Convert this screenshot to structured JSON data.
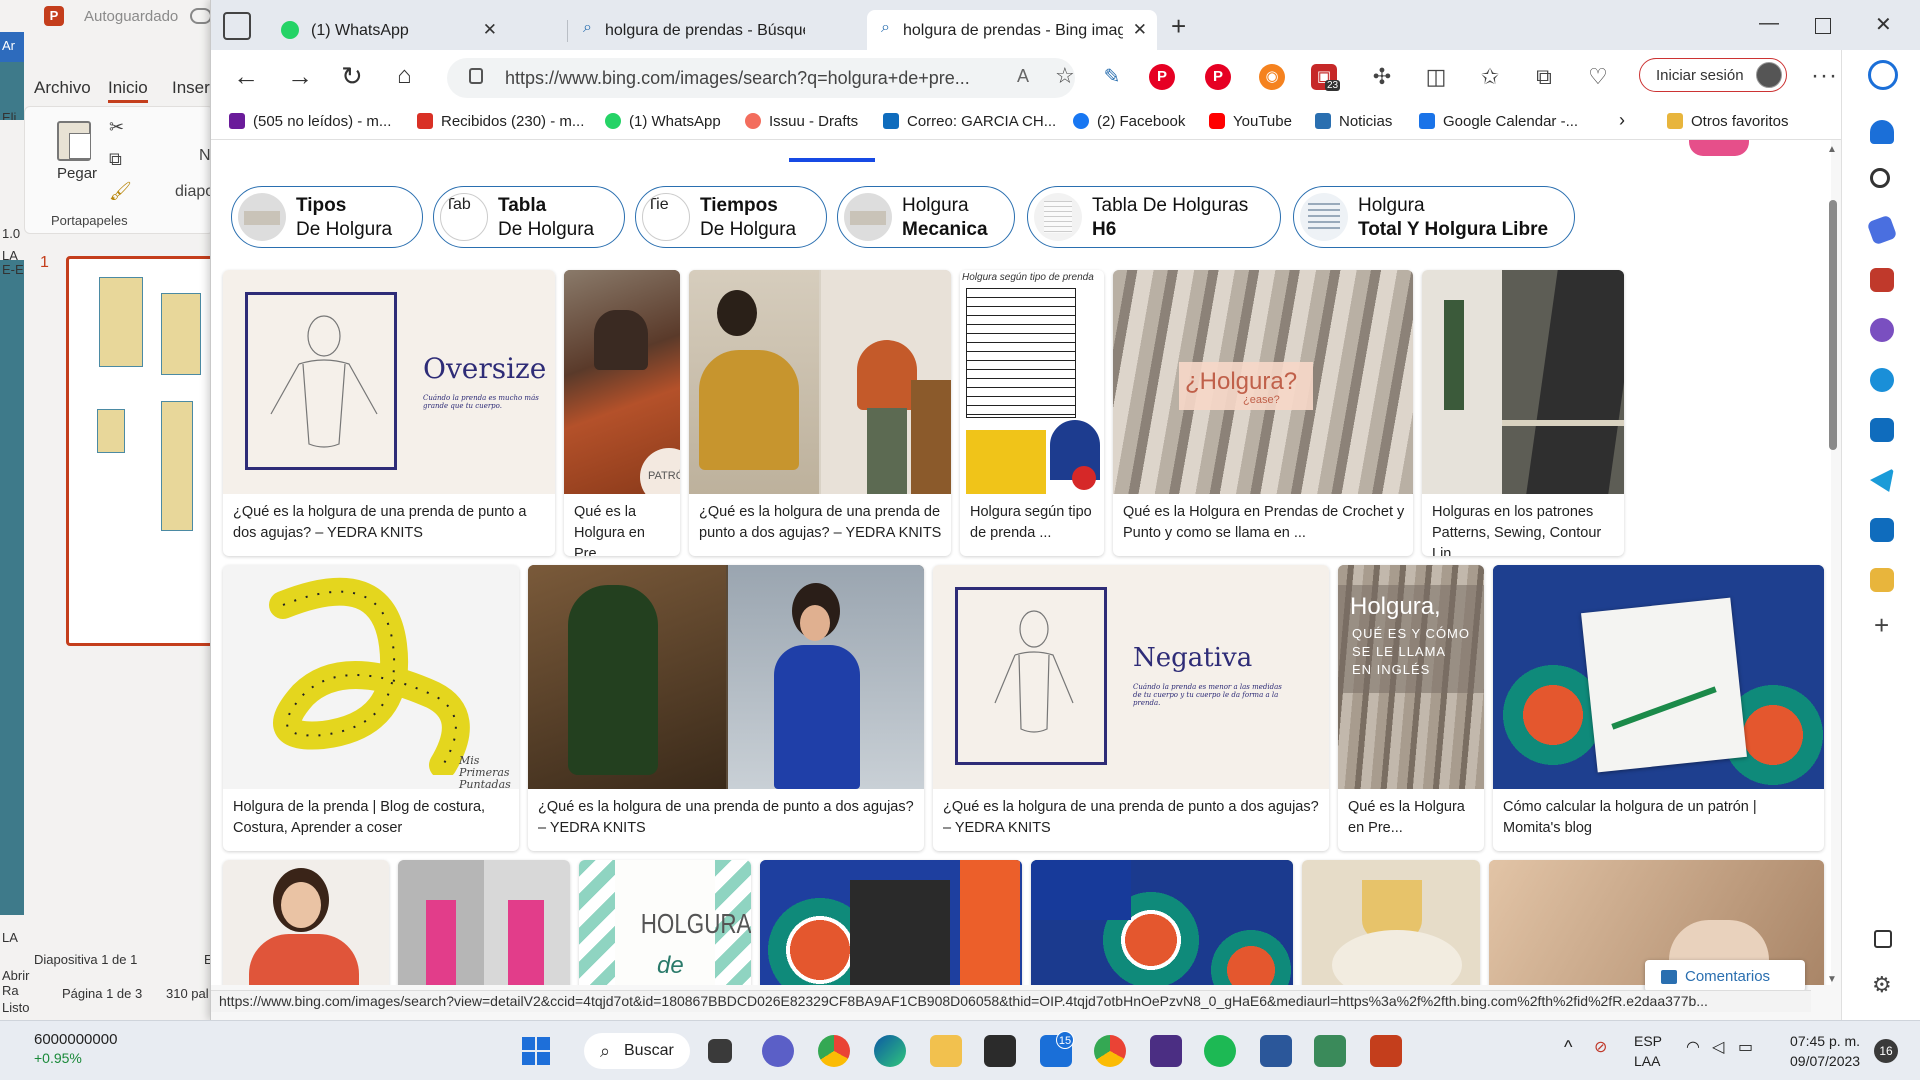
{
  "powerpoint": {
    "autosave_label": "Autoguardado",
    "left_labels": [
      "Ar",
      "Eli",
      "1.0",
      "LA",
      "E-E",
      "LA",
      "Abrir Ra",
      "Listo"
    ],
    "menu": [
      "Archivo",
      "Inicio",
      "Inser"
    ],
    "paste_label": "Pegar",
    "clipboard_group": "Portapapeles",
    "new_slide_label": "N",
    "slides_label": "diapo",
    "slide_number": "1",
    "status_slide": "Diapositiva 1 de 1",
    "status_e": "E",
    "status_page": "Página 1 de 3",
    "status_words": "310 pal"
  },
  "browser": {
    "tabs": [
      {
        "label": "(1) WhatsApp",
        "icon": "whatsapp-icon",
        "color": "#25d366"
      },
      {
        "label": "holgura de prendas - Búsqueda",
        "icon": "search-icon",
        "color": "#2a6fb0"
      },
      {
        "label": "holgura de prendas - Bing image",
        "icon": "search-icon",
        "color": "#2a6fb0"
      }
    ],
    "url": "https://www.bing.com/images/search?q=holgura+de+pre...",
    "read_aloud": "À",
    "sign_in": "Iniciar sesión",
    "ext_badge": "23",
    "favorites": [
      {
        "label": "(505 no leídos) - m...",
        "color": "#6a1b9a"
      },
      {
        "label": "Recibidos (230) - m...",
        "color": "#d93025"
      },
      {
        "label": "(1) WhatsApp",
        "color": "#25d366"
      },
      {
        "label": "Issuu - Drafts",
        "color": "#f36d5d"
      },
      {
        "label": "Correo: GARCIA CH...",
        "color": "#0f6cbd"
      },
      {
        "label": "(2) Facebook",
        "color": "#1877f2"
      },
      {
        "label": "YouTube",
        "color": "#ff0000"
      },
      {
        "label": "Noticias",
        "color": "#2a6fb0"
      },
      {
        "label": "Google Calendar -...",
        "color": "#1a73e8"
      }
    ],
    "other_favorites": "Otros favoritos",
    "status_url": "https://www.bing.com/images/search?view=detailV2&ccid=4tqjd7ot&id=180867BBDCD026E82329CF8BA9AF1CB908D06058&thid=OIP.4tqjd7otbHnOePzvN8_0_gHaE6&mediaurl=https%3a%2f%2fth.bing.com%2fth%2fid%2fR.e2daa377b...",
    "comments": "Comentarios"
  },
  "chips": [
    {
      "l1": "Tipos",
      "l2": "De Holgura",
      "bold_line": 1
    },
    {
      "l1": "Tabla",
      "l2": "De Holgura",
      "bold_line": 1
    },
    {
      "l1": "Tiempos",
      "l2": "De Holgura",
      "bold_line": 1
    },
    {
      "l1": "Holgura",
      "l2": "Mecanica",
      "bold_line": 2
    },
    {
      "l1": "Tabla De Holguras",
      "l2": "H6",
      "bold_line": 2
    },
    {
      "l1": "Holgura",
      "l2": "Total Y Holgura Libre",
      "bold_line": 2
    }
  ],
  "chip_alt_texts": [
    "Tab",
    "Tie"
  ],
  "results": [
    {
      "caption": "¿Qué es la holgura de una prenda de punto a dos agujas? – YEDRA KNITS",
      "img_text": "Oversize"
    },
    {
      "caption": "Qué es la Holgura en Pre...",
      "img_text": "PATRÓN"
    },
    {
      "caption": "¿Qué es la holgura de una prenda de punto a dos agujas? – YEDRA KNITS",
      "img_text": ""
    },
    {
      "caption": "Holgura según tipo de prenda ...",
      "img_text": "Holgura según tipo de prenda"
    },
    {
      "caption": "Qué es la Holgura en Prendas de Crochet y Punto y como se llama en ...",
      "img_text": "¿Holgura?"
    },
    {
      "caption": "Holguras en los patrones Patterns, Sewing, Contour Lin...",
      "img_text": ""
    },
    {
      "caption": "Holgura de la prenda | Blog de costura, Costura, Aprender a coser",
      "img_text": "Mis Primeras Puntadas"
    },
    {
      "caption": "¿Qué es la holgura de una prenda de punto a dos agujas? – YEDRA KNITS",
      "img_text": ""
    },
    {
      "caption": "¿Qué es la holgura de una prenda de punto a dos agujas? – YEDRA KNITS",
      "img_text": "Negativa"
    },
    {
      "caption": "Qué es la Holgura en Pre...",
      "img_text": "Holgura,"
    },
    {
      "caption": "Cómo calcular la holgura de un patrón | Momita's blog",
      "img_text": ""
    }
  ],
  "row3_text": "HOLGURAS",
  "row3_sub": "de",
  "img_text_extra": {
    "oversize_sub": "Cuándo la prenda es mucho más grande que tu cuerpo.",
    "ease": "¿ease?",
    "holgura_sub": [
      "QUÉ ES Y CÓMO",
      "SE LE LLAMA",
      "EN INGLÉS"
    ],
    "negativa_sub": "Cuándo la prenda es menor a las medidas de tu cuerpo y tu cuerpo le da forma a la prenda."
  },
  "taskbar": {
    "stock_value": "6000000000",
    "stock_change": "+0.95%",
    "search_label": "Buscar",
    "mail_badge": "15",
    "lang1": "ESP",
    "lang2": "LAA",
    "time": "07:45 p. m.",
    "date": "09/07/2023",
    "notifications": "16"
  }
}
